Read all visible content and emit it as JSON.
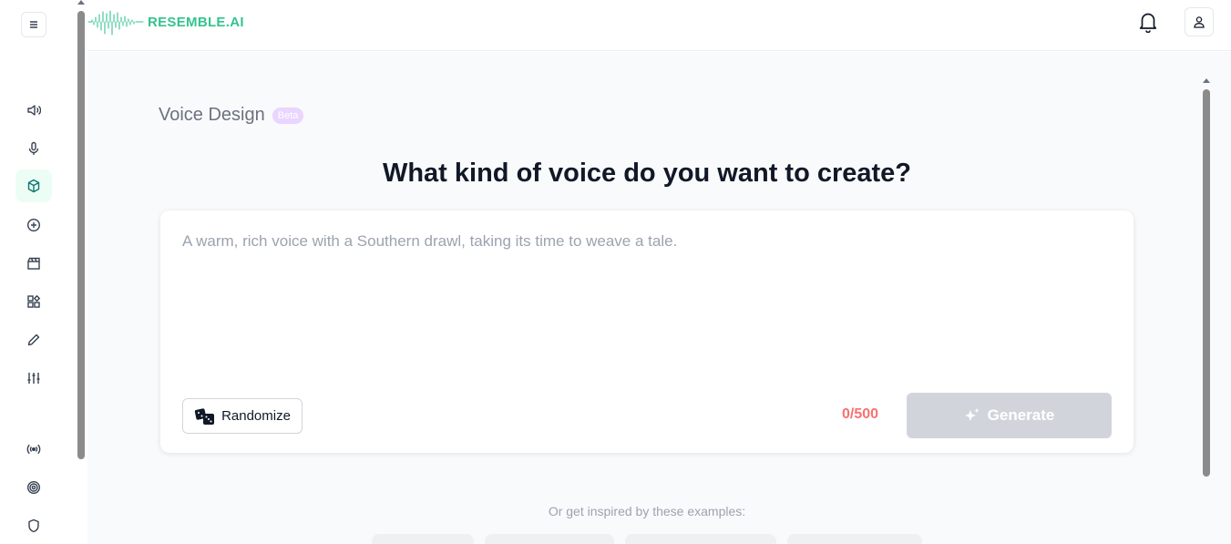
{
  "app": {
    "logo_text": "RESEMBLE.AI",
    "brand_color": "#34c38f"
  },
  "sidebar": {
    "items": [
      {
        "icon": "menu-icon"
      },
      {
        "icon": "speaker-icon"
      },
      {
        "icon": "microphone-icon"
      },
      {
        "icon": "cube-icon",
        "active": true
      },
      {
        "icon": "plus-circle-icon"
      },
      {
        "icon": "clapperboard-icon"
      },
      {
        "icon": "apps-grid-icon"
      },
      {
        "icon": "pencil-icon"
      },
      {
        "icon": "sliders-icon"
      },
      {
        "icon": "broadcast-icon"
      },
      {
        "icon": "target-icon"
      },
      {
        "icon": "shield-icon"
      }
    ]
  },
  "header": {
    "icons": [
      "bell-icon",
      "user-icon"
    ]
  },
  "page": {
    "title": "Voice Design",
    "badge": "Beta",
    "heading": "What kind of voice do you want to create?",
    "prompt_placeholder": "A warm, rich voice with a Southern drawl, taking its time to weave a tale.",
    "prompt_value": "",
    "randomize_label": "Randomize",
    "char_count": "0/500",
    "generate_label": "Generate",
    "inspired_text": "Or get inspired by these examples:"
  }
}
